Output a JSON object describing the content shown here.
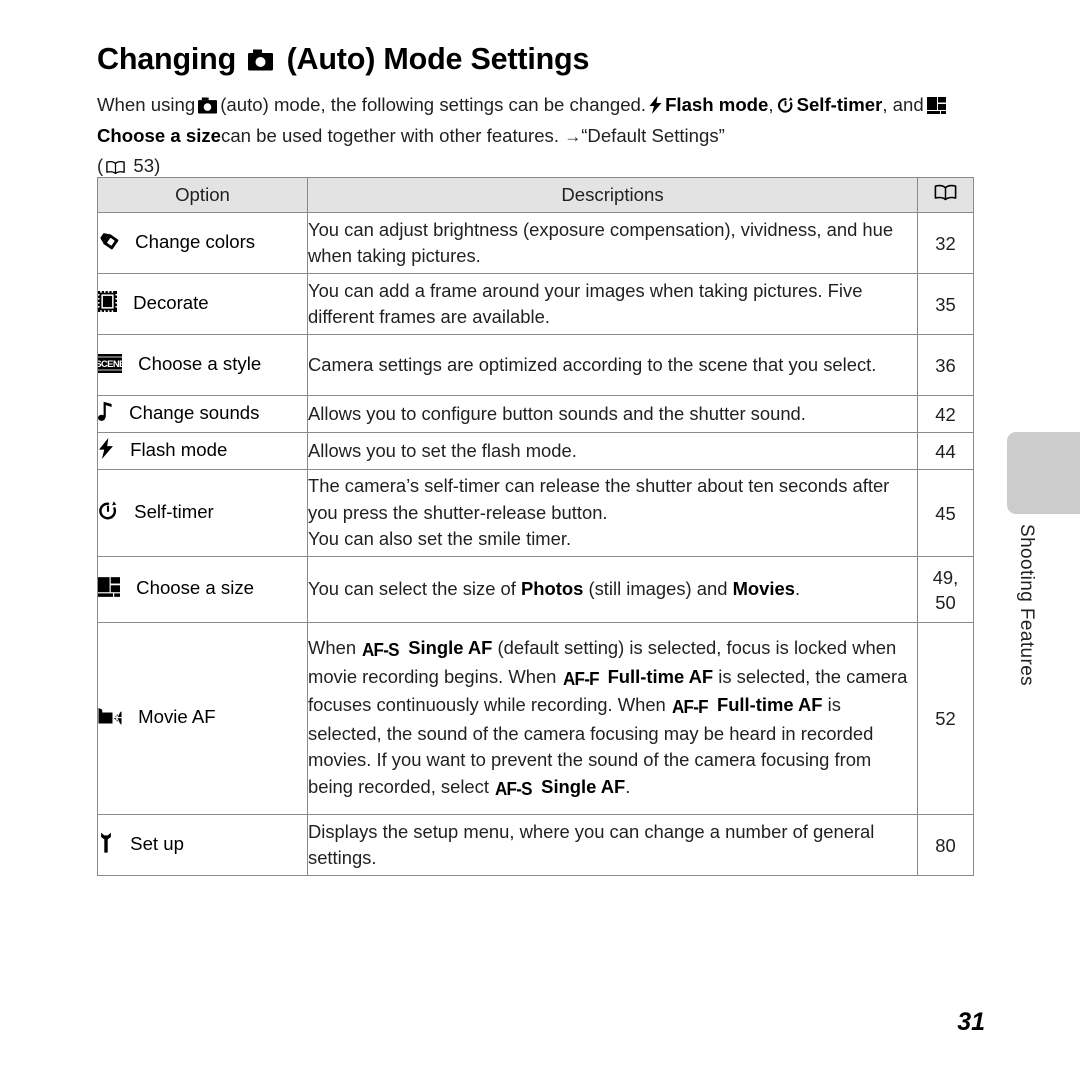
{
  "page": {
    "folio": "31",
    "side_tab_label": "Shooting Features"
  },
  "title": {
    "before": "Changing",
    "icon": "camera-auto-icon",
    "after": "(Auto) Mode Settings"
  },
  "intro": {
    "seg1": "When using",
    "icon1": "camera-auto-icon",
    "seg2": "(auto) mode, the following settings can be changed.",
    "icon2": "flash-icon",
    "bold1": "Flash mode",
    "comma1": ",",
    "icon3": "self-timer-icon",
    "bold2": "Self-timer",
    "seg3": ", and",
    "icon4": "image-size-icon",
    "bold3": "Choose a size",
    "seg4": "can be used together with other features.",
    "arrow": "→",
    "quote": "“Default Settings”",
    "ref_open": "(",
    "ref_icon": "book-icon",
    "ref_page": "53",
    "ref_close": ")"
  },
  "table": {
    "headers": {
      "option": "Option",
      "descriptions": "Descriptions",
      "page_icon": "book-icon"
    },
    "rows": [
      {
        "icon": "marker-pen-icon",
        "option": "Change colors",
        "desc_plain": "You can adjust brightness (exposure compensation), vividness, and hue when taking pictures.",
        "page": "32"
      },
      {
        "icon": "decorate-frame-icon",
        "option": "Decorate",
        "desc_plain": "You can add a frame around your images when taking pictures. Five different frames are available.",
        "page": "35"
      },
      {
        "icon": "scene-icon",
        "option": "Choose a style",
        "desc_plain": "Camera settings are optimized according to the scene that you select.",
        "page": "36"
      },
      {
        "icon": "music-note-icon",
        "option": "Change sounds",
        "desc_plain": "Allows you to configure button sounds and the shutter sound.",
        "page": "42"
      },
      {
        "icon": "flash-icon",
        "option": "Flash mode",
        "desc_plain": "Allows you to set the flash mode.",
        "page": "44"
      },
      {
        "icon": "self-timer-icon",
        "option": "Self-timer",
        "desc_line1": "The camera’s self-timer can release the shutter about ten seconds after you press the shutter-release button.",
        "desc_line2": "You can also set the smile timer.",
        "page": "45"
      },
      {
        "icon": "image-size-icon",
        "option": "Choose a size",
        "desc_seg1": "You can select the size of",
        "desc_bold1": "Photos",
        "desc_seg2": "(still images) and",
        "desc_bold2": "Movies",
        "desc_seg3": ".",
        "page": "49,\n50"
      },
      {
        "icon": "movie-camera-icon",
        "option": "Movie AF",
        "desc_seg1": "When",
        "desc_afs1": "AF-S",
        "desc_bold1": "Single AF",
        "desc_seg2": "(default setting) is selected, focus is locked when movie recording begins. When",
        "desc_aff1": "AF-F",
        "desc_bold2": "Full-time AF",
        "desc_seg3": "is selected, the camera focuses continuously while recording. When",
        "desc_aff2": "AF-F",
        "desc_bold3": "Full-time AF",
        "desc_seg4": "is selected, the sound of the camera focusing may be heard in recorded movies. If you want to prevent the sound of the camera focusing from being recorded, select",
        "desc_afs2": "AF-S",
        "desc_bold4": "Single AF",
        "desc_seg5": ".",
        "page": "52"
      },
      {
        "icon": "wrench-icon",
        "option": "Set up",
        "desc_plain": "Displays the setup menu, where you can change a number of general settings.",
        "page": "80"
      }
    ]
  },
  "colors": {
    "text": "#231f20",
    "header_bg": "#e3e3e3",
    "border": "#8a8a8a",
    "side_tab": "#cccccc"
  }
}
